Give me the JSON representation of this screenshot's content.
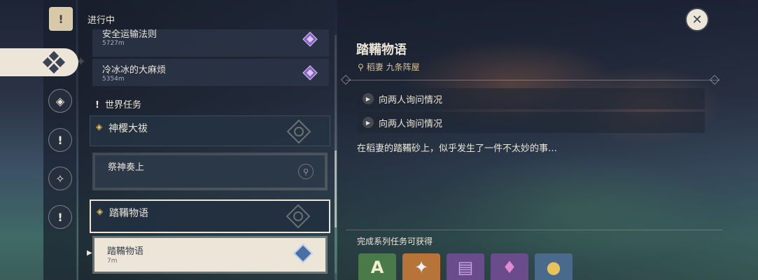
{
  "header": {
    "title": "进行中"
  },
  "rail": {
    "icons": [
      "quest-scroll-icon",
      "archon-quest-icon",
      "story-quest-icon",
      "world-quest-icon",
      "commission-icon",
      "event-quest-icon"
    ]
  },
  "quest_list": {
    "top_cards": [
      {
        "title": "安全运输法则",
        "distance": "5727m",
        "icon": "purple-gem-icon"
      },
      {
        "title": "冷冰冰的大麻烦",
        "distance": "5354m",
        "icon": "purple-gem-icon"
      }
    ],
    "section": {
      "icon": "!",
      "label": "世界任务"
    },
    "groups": [
      {
        "title": "神樱大祓",
        "mark": "◈",
        "sub": {
          "title": "祭神奏上",
          "pin": "⚲"
        }
      },
      {
        "title": "踏鞴物语",
        "mark": "◈",
        "sub": {
          "title": "踏鞴物语",
          "distance": "7m"
        }
      }
    ]
  },
  "detail": {
    "title": "踏鞴物语",
    "location_pin": "⚲",
    "location": "稻妻 九条阵屋",
    "objectives": [
      {
        "text": "向两人询问情况"
      },
      {
        "text": "向两人询问情况"
      }
    ],
    "description": "在稻妻的踏鞴砂上，似乎发生了一件不太妙的事…",
    "rewards_label": "完成系列任务可获得",
    "rewards": [
      {
        "name": "adventure-exp-icon",
        "glyph": "A",
        "bg": "#4a7a4a"
      },
      {
        "name": "primogem-icon",
        "glyph": "✦",
        "bg": "#b7743a"
      },
      {
        "name": "heros-wit-icon",
        "glyph": "▤",
        "bg": "#6a4c8c"
      },
      {
        "name": "crystal-icon",
        "glyph": "♦",
        "bg": "#6a4c8c"
      },
      {
        "name": "mora-icon",
        "glyph": "●",
        "bg": "#4a6a8c"
      }
    ]
  },
  "close": {
    "glyph": "✕"
  }
}
